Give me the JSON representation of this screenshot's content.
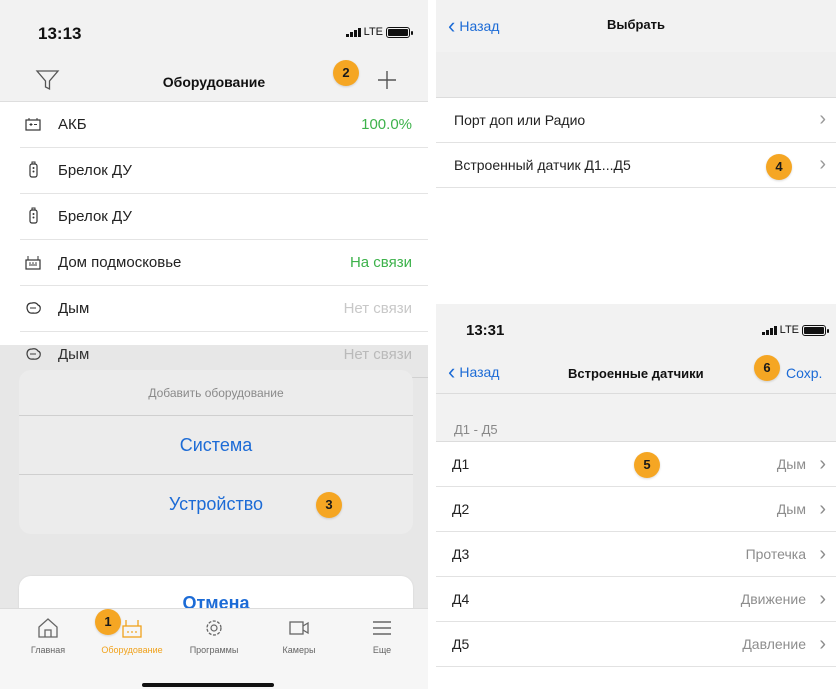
{
  "left": {
    "status": {
      "time": "13:13",
      "network": "LTE"
    },
    "navbar": {
      "title": "Оборудование",
      "filter_icon": "filter-icon",
      "add_icon": "plus-icon"
    },
    "devices": [
      {
        "icon": "battery-icon",
        "name": "АКБ",
        "value": "100.0%",
        "value_color": "#3db24b"
      },
      {
        "icon": "keyfob-icon",
        "name": "Брелок ДУ",
        "value": ""
      },
      {
        "icon": "keyfob-icon",
        "name": "Брелок ДУ",
        "value": ""
      },
      {
        "icon": "house-icon",
        "name": "Дом подмосковье",
        "value": "На связи",
        "value_color": "#3db24b"
      },
      {
        "icon": "smoke-icon",
        "name": "Дым",
        "value": "Нет связи"
      },
      {
        "icon": "smoke-icon",
        "name": "Дым",
        "value": "Нет связи"
      }
    ],
    "sheet": {
      "title": "Добавить оборудование",
      "options": [
        "Система",
        "Устройство"
      ],
      "cancel": "Отмена"
    },
    "tabs": [
      {
        "icon": "home-icon",
        "label": "Главная"
      },
      {
        "icon": "equipment-icon",
        "label": "Оборудование",
        "active": true
      },
      {
        "icon": "gear-icon",
        "label": "Программы"
      },
      {
        "icon": "camera-icon",
        "label": "Камеры"
      },
      {
        "icon": "menu-icon",
        "label": "Еще"
      }
    ],
    "accent_color": "#f0a21c"
  },
  "right_top": {
    "nav": {
      "back": "Назад",
      "title": "Выбрать"
    },
    "rows": [
      "Порт доп или Радио",
      "Встроенный датчик Д1...Д5"
    ]
  },
  "right_bottom": {
    "status": {
      "time": "13:31",
      "network": "LTE"
    },
    "nav": {
      "back": "Назад",
      "title": "Встроенные датчики",
      "save": "Сохр."
    },
    "section": "Д1 - Д5",
    "rows": [
      {
        "label": "Д1",
        "value": "Дым"
      },
      {
        "label": "Д2",
        "value": "Дым"
      },
      {
        "label": "Д3",
        "value": "Протечка"
      },
      {
        "label": "Д4",
        "value": "Движение"
      },
      {
        "label": "Д5",
        "value": "Давление"
      }
    ]
  },
  "badges": [
    "1",
    "2",
    "3",
    "4",
    "5",
    "6"
  ],
  "colors": {
    "link": "#1c6bd6",
    "badge": "#f5a623",
    "online": "#3db24b"
  }
}
